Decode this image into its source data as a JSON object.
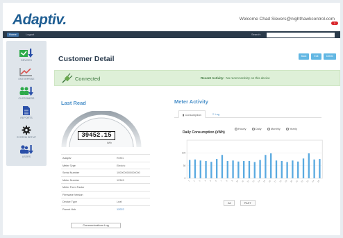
{
  "header": {
    "logo": "Adaptiv.",
    "welcome": "Welcome Chad Sievers@nighthawkcontrol.com",
    "notification_count": "1"
  },
  "navbar": {
    "home": "Home",
    "logout": "Logout",
    "search_label": "Search:",
    "search_value": ""
  },
  "sidebar": {
    "items": [
      {
        "label": "DEVICES",
        "icon": "device-arrow-icon",
        "color": "#2eaa4a"
      },
      {
        "label": "ENTERPRISE",
        "icon": "line-chart-icon",
        "color": "#d9534f"
      },
      {
        "label": "CUSTOMERS",
        "icon": "customers-icon",
        "color": "#2eaa4a"
      },
      {
        "label": "REPORTS",
        "icon": "document-icon",
        "color": "#2a4fa8"
      },
      {
        "label": "SYSTEM SETUP",
        "icon": "gear-icon",
        "color": "#222222"
      },
      {
        "label": "USERS",
        "icon": "users-icon",
        "color": "#2a4fa8"
      }
    ]
  },
  "page": {
    "title": "Customer Detail",
    "buttons": [
      "Back",
      "Edit",
      "Delete"
    ]
  },
  "status": {
    "connected": "Connected",
    "recent_label": "Recent Activity:",
    "recent_value": "No recent activity on this device"
  },
  "last_read": {
    "title": "Last Read",
    "value": "39452.15",
    "unit": "kWh"
  },
  "info": [
    {
      "key": "Adaptiv",
      "value": "Ref01",
      "link": false
    },
    {
      "key": "Meter Type",
      "value": "Electric",
      "link": false
    },
    {
      "key": "Serial Number",
      "value": "1000000000000000",
      "link": false
    },
    {
      "key": "Meter Number",
      "value": "12345",
      "link": false
    },
    {
      "key": "Meter Form Factor",
      "value": "",
      "link": false
    },
    {
      "key": "Firmware Version",
      "value": "",
      "link": false
    },
    {
      "key": "Device Type",
      "value": "Leaf",
      "link": false
    },
    {
      "key": "Parent Hub",
      "value": "12022",
      "link": true
    }
  ],
  "comm_button": "Communications Log",
  "meter_activity": {
    "title": "Meter Activity",
    "tabs": [
      "Consumption",
      "Log"
    ],
    "chart_title": "Daily Consumption (kWh)",
    "radios": [
      "Hourly",
      "Daily",
      "Monthly",
      "Yearly"
    ],
    "pager_all": "All",
    "pager_past": "PAST"
  },
  "chart_data": {
    "type": "bar",
    "title": "Daily Consumption (kWh)",
    "ylim": [
      0,
      150
    ],
    "yticks": [
      0,
      50,
      100
    ],
    "categories": [
      "1",
      "2",
      "3",
      "4",
      "5",
      "6",
      "7",
      "8",
      "9",
      "10",
      "11",
      "12",
      "13",
      "14",
      "15",
      "16",
      "17",
      "18",
      "19",
      "20",
      "21",
      "22",
      "23",
      "24",
      "25"
    ],
    "values": [
      72,
      74,
      70,
      68,
      65,
      76,
      92,
      68,
      70,
      66,
      68,
      68,
      64,
      72,
      92,
      98,
      70,
      68,
      64,
      70,
      66,
      78,
      98,
      74,
      76
    ],
    "bar_color": "#5aaae0",
    "grid": true
  }
}
